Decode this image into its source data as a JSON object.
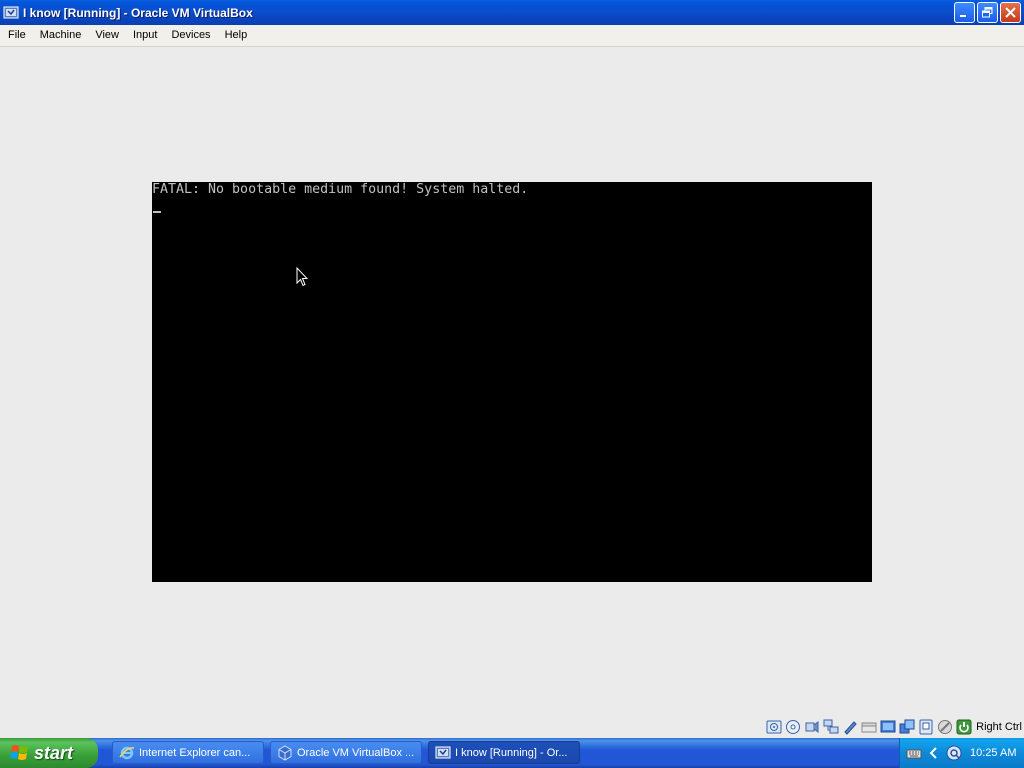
{
  "window": {
    "title": "I know [Running] - Oracle VM VirtualBox"
  },
  "menu": [
    "File",
    "Machine",
    "View",
    "Input",
    "Devices",
    "Help"
  ],
  "vm_screen": {
    "console_text": "FATAL: No bootable medium found! System halted."
  },
  "statusbar": {
    "icons": [
      "hard-disk-icon",
      "optical-drive-icon",
      "audio-icon",
      "network-icon",
      "shared-folders-icon",
      "usb-icon",
      "display-icon",
      "video-capture-icon",
      "virtualization-icon",
      "mouse-integration-icon",
      "cpu-icon"
    ],
    "host_key": "Right Ctrl"
  },
  "taskbar": {
    "start_label": "start",
    "tasks": [
      {
        "label": "Internet Explorer can...",
        "icon": "ie-icon",
        "active": false
      },
      {
        "label": "Oracle VM VirtualBox ...",
        "icon": "virtualbox-icon",
        "active": false
      },
      {
        "label": "I know [Running] - Or...",
        "icon": "virtualbox-vm-icon",
        "active": true
      }
    ],
    "clock": "10:25 AM"
  },
  "colors": {
    "titlebar_blue": "#0a4ecc",
    "vm_background": "#000000",
    "console_text": "#c0c0c0",
    "start_green": "#389f38",
    "close_red": "#c23b16"
  }
}
